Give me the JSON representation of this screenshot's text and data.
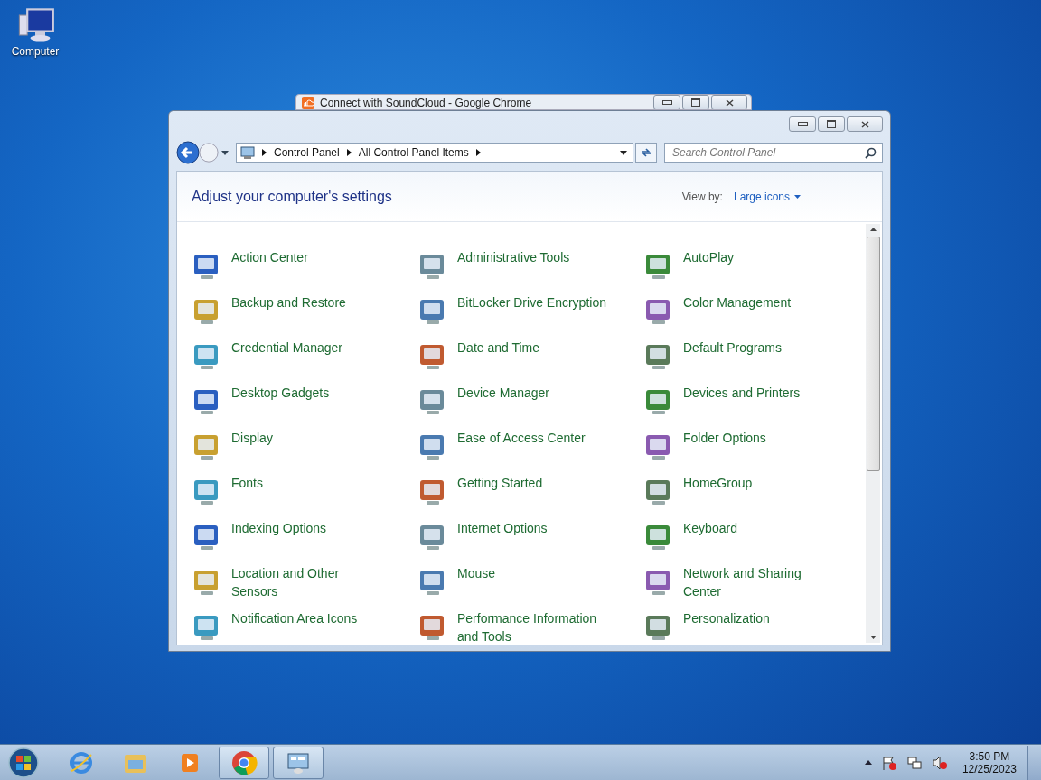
{
  "desktop_icons": [
    {
      "label": "Computer"
    }
  ],
  "background_window": {
    "title": "Connect with SoundCloud - Google Chrome"
  },
  "window": {
    "breadcrumb": [
      "Control Panel",
      "All Control Panel Items"
    ],
    "search": {
      "placeholder": "Search Control Panel"
    },
    "heading": "Adjust your computer's settings",
    "view_by": {
      "label": "View by:",
      "value": "Large icons"
    },
    "items": [
      {
        "label": "Action Center"
      },
      {
        "label": "Administrative Tools"
      },
      {
        "label": "AutoPlay"
      },
      {
        "label": "Backup and Restore"
      },
      {
        "label": "BitLocker Drive Encryption"
      },
      {
        "label": "Color Management"
      },
      {
        "label": "Credential Manager"
      },
      {
        "label": "Date and Time"
      },
      {
        "label": "Default Programs"
      },
      {
        "label": "Desktop Gadgets"
      },
      {
        "label": "Device Manager"
      },
      {
        "label": "Devices and Printers"
      },
      {
        "label": "Display"
      },
      {
        "label": "Ease of Access Center"
      },
      {
        "label": "Folder Options"
      },
      {
        "label": "Fonts"
      },
      {
        "label": "Getting Started"
      },
      {
        "label": "HomeGroup"
      },
      {
        "label": "Indexing Options"
      },
      {
        "label": "Internet Options"
      },
      {
        "label": "Keyboard"
      },
      {
        "label": "Location and Other Sensors"
      },
      {
        "label": "Mouse"
      },
      {
        "label": "Network and Sharing Center"
      },
      {
        "label": "Notification Area Icons"
      },
      {
        "label": "Performance Information and Tools"
      },
      {
        "label": "Personalization"
      }
    ]
  },
  "taskbar": {
    "apps": [
      {
        "kind": "browser",
        "open": false
      },
      {
        "kind": "folder",
        "open": false
      },
      {
        "kind": "media",
        "open": false
      },
      {
        "kind": "chrome",
        "open": true
      },
      {
        "kind": "panel",
        "open": true
      }
    ],
    "clock": {
      "time": "3:50 PM",
      "date": "12/25/2023"
    }
  }
}
